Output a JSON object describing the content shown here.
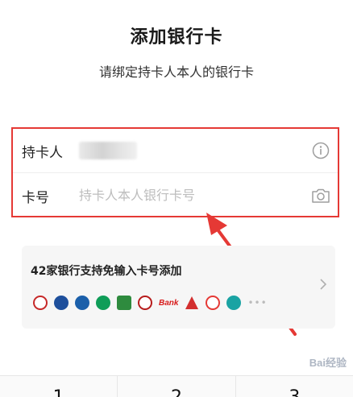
{
  "page": {
    "title": "添加银行卡",
    "subtitle": "请绑定持卡人本人的银行卡"
  },
  "form": {
    "holder_label": "持卡人",
    "card_label": "卡号",
    "card_placeholder": "持卡人本人银行卡号"
  },
  "icons": {
    "info": "info-icon",
    "camera": "camera-icon",
    "chevron": "chevron-right-icon"
  },
  "promo": {
    "title": "42家银行支持免输入卡号添加",
    "banks": [
      "ICBC",
      "Bank of Communications",
      "Everbright",
      "ABC",
      "Postal Savings",
      "Bank of China",
      "Bank",
      "Construction Bank",
      "China Merchants",
      "Minsheng"
    ],
    "bank_text": "Bank"
  },
  "keypad": {
    "keys": [
      "1",
      "2",
      "3"
    ]
  },
  "watermark": "Bai经验",
  "colors": {
    "highlight": "#e53935",
    "placeholder": "#bdbdbd"
  }
}
